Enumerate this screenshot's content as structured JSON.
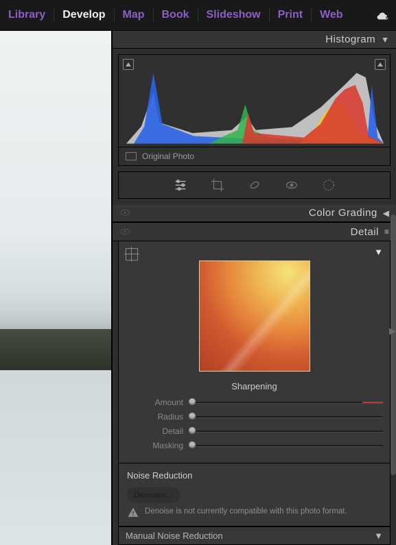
{
  "topbar": {
    "modules": [
      "Library",
      "Develop",
      "Map",
      "Book",
      "Slideshow",
      "Print",
      "Web"
    ],
    "active_index": 1
  },
  "panels": {
    "histogram": {
      "title": "Histogram",
      "photo_label": "Original Photo",
      "ticks": [
        "–",
        "–",
        "–",
        "–",
        "–"
      ]
    },
    "color_grading": {
      "title": "Color Grading"
    },
    "detail": {
      "title": "Detail",
      "sharpening": {
        "heading": "Sharpening",
        "sliders": [
          {
            "label": "Amount",
            "pos": 0
          },
          {
            "label": "Radius",
            "pos": 0
          },
          {
            "label": "Detail",
            "pos": 0
          },
          {
            "label": "Masking",
            "pos": 0
          }
        ]
      },
      "noise_reduction": {
        "heading": "Noise Reduction",
        "denoise_button": "Denoise...",
        "warning": "Denoise is not currently compatible with this photo format."
      },
      "manual_nr": {
        "heading": "Manual Noise Reduction"
      }
    }
  },
  "toolbar_icons": [
    "sliders-icon",
    "crop-icon",
    "heal-icon",
    "redeye-icon",
    "radial-icon"
  ]
}
